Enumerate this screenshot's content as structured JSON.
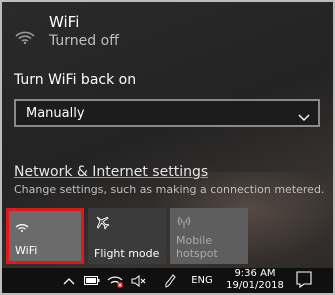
{
  "wifi": {
    "title": "WiFi",
    "status": "Turned off",
    "icon": "wifi-off-icon"
  },
  "turn_back": {
    "label": "Turn WiFi back on",
    "selected": "Manually"
  },
  "network_settings": {
    "link": "Network & Internet settings",
    "description": "Change settings, such as making a connection metered."
  },
  "quick_actions": [
    {
      "label": "WiFi",
      "icon": "wifi-icon",
      "state": "off",
      "highlighted": true
    },
    {
      "label": "Flight mode",
      "icon": "airplane-icon",
      "state": "off"
    },
    {
      "label": "Mobile hotspot",
      "icon": "hotspot-icon",
      "state": "disabled"
    }
  ],
  "taskbar": {
    "language": "ENG",
    "time": "9:36 AM",
    "date": "19/01/2018",
    "icons": [
      "chevron-up-icon",
      "battery-icon",
      "network-icon",
      "volume-muted-icon",
      "pen-icon",
      "notification-icon"
    ]
  },
  "colors": {
    "highlight_border": "#e01818",
    "tile_active": "#6b6b6b",
    "tile_inactive": "#3b3b3b"
  }
}
